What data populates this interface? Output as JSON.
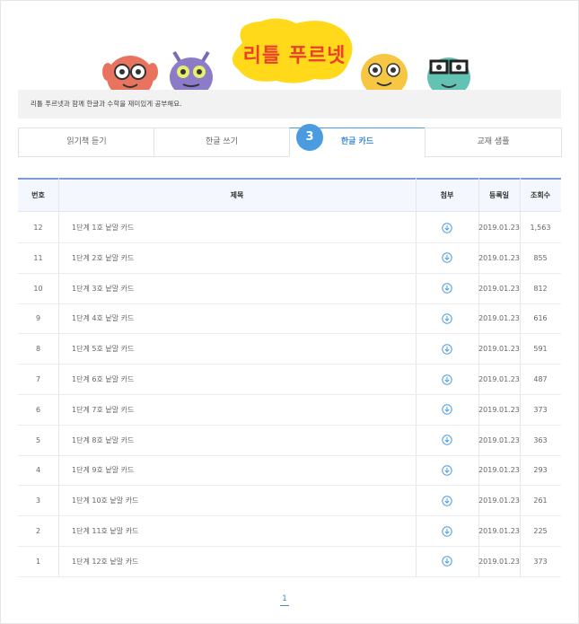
{
  "header": {
    "logo_text": "리틀 푸르넷",
    "intro_text": "리틀 푸르넷과 함께 한글과 수학을 재미있게 공부해요."
  },
  "step_badge": "3",
  "tabs": [
    {
      "label": "읽기책 듣기"
    },
    {
      "label": "한글 쓰기"
    },
    {
      "label": "한글 카드"
    },
    {
      "label": "교재 샘플"
    }
  ],
  "table": {
    "headers": {
      "no": "번호",
      "title": "제목",
      "attach": "첨부",
      "date": "등록일",
      "views": "조회수"
    },
    "rows": [
      {
        "no": "12",
        "title": "1단계 1호 낱말 카드",
        "date": "2019.01.23",
        "views": "1,563"
      },
      {
        "no": "11",
        "title": "1단계 2호 낱말 카드",
        "date": "2019.01.23",
        "views": "855"
      },
      {
        "no": "10",
        "title": "1단계 3호 낱말 카드",
        "date": "2019.01.23",
        "views": "812"
      },
      {
        "no": "9",
        "title": "1단계 4호 낱말 카드",
        "date": "2019.01.23",
        "views": "616"
      },
      {
        "no": "8",
        "title": "1단계 5호 낱말 카드",
        "date": "2019.01.23",
        "views": "591"
      },
      {
        "no": "7",
        "title": "1단계 6호 낱말 카드",
        "date": "2019.01.23",
        "views": "487"
      },
      {
        "no": "6",
        "title": "1단계 7호 낱말 카드",
        "date": "2019.01.23",
        "views": "373"
      },
      {
        "no": "5",
        "title": "1단계 8호 낱말 카드",
        "date": "2019.01.23",
        "views": "363"
      },
      {
        "no": "4",
        "title": "1단계 9호 낱말 카드",
        "date": "2019.01.23",
        "views": "293"
      },
      {
        "no": "3",
        "title": "1단계 10호 낱말 카드",
        "date": "2019.01.23",
        "views": "261"
      },
      {
        "no": "2",
        "title": "1단계 11호 낱말 카드",
        "date": "2019.01.23",
        "views": "225"
      },
      {
        "no": "1",
        "title": "1단계 12호 낱말 카드",
        "date": "2019.01.23",
        "views": "373"
      }
    ]
  },
  "pagination": {
    "current": "1"
  },
  "colors": {
    "accent": "#4a9be0",
    "header_border": "#7d9bd6"
  },
  "icons": {
    "attachment": "download-circle-icon"
  }
}
